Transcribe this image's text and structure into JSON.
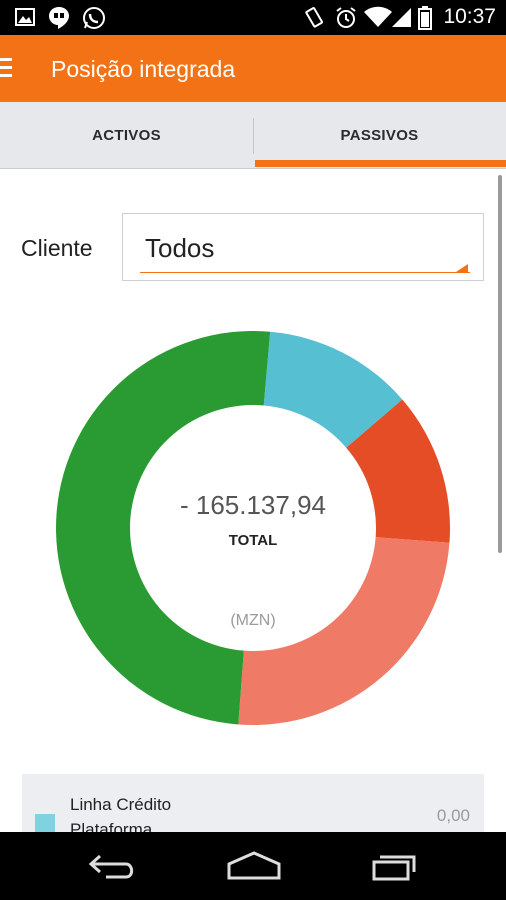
{
  "status_bar": {
    "time": "10:37",
    "left_icons": [
      "image-icon",
      "hangouts-icon",
      "whatsapp-icon"
    ],
    "right_icons": [
      "vibrate-icon",
      "alarm-icon",
      "wifi-icon",
      "signal-icon",
      "battery-icon"
    ]
  },
  "app_bar": {
    "title": "Posição integrada",
    "background_color": "#f47216"
  },
  "tabs": [
    {
      "label": "ACTIVOS",
      "selected": false
    },
    {
      "label": "PASSIVOS",
      "selected": true
    }
  ],
  "filter": {
    "label": "Cliente",
    "selected_value": "Todos"
  },
  "summary": {
    "total_value": "- 165.137,94",
    "total_label": "TOTAL",
    "currency": "(MZN)"
  },
  "donut_segments": [
    {
      "color": "#56bfd2",
      "share": 0.123
    },
    {
      "color": "#e44d26",
      "share": 0.125
    },
    {
      "color": "#ef7b66",
      "share": 0.25
    },
    {
      "color": "#2a9b32",
      "share": 0.502
    }
  ],
  "legend": [
    {
      "label": "Linha Crédito Plataforma",
      "value": "0,00",
      "color": "#7fd2e0"
    }
  ],
  "nav_bar": {
    "buttons": [
      "back-icon",
      "home-icon",
      "recents-icon"
    ]
  }
}
